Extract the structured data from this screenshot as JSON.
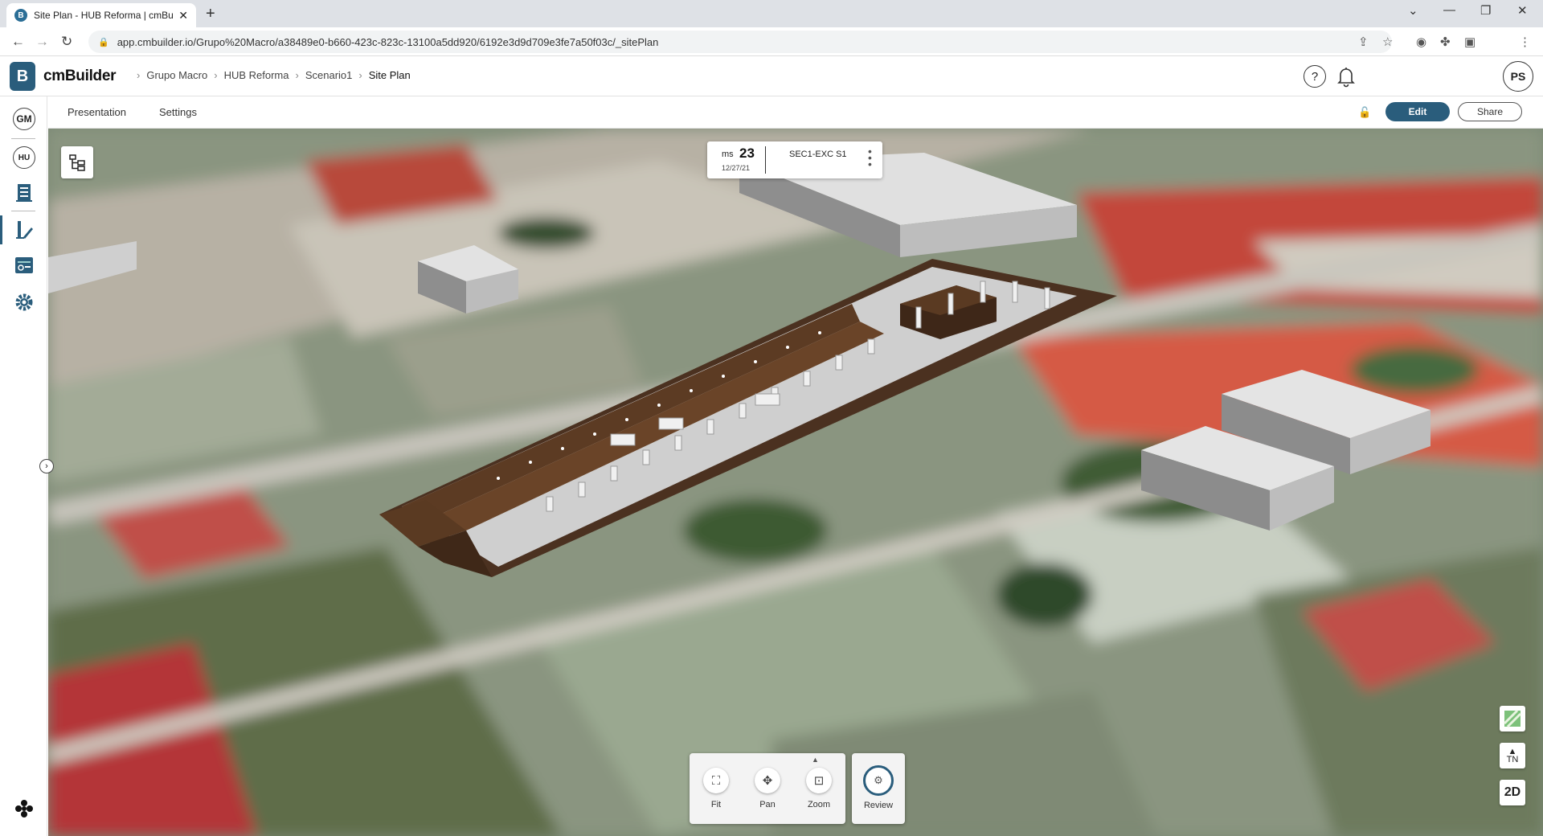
{
  "browser": {
    "tab_title": "Site Plan - HUB Reforma | cmBuil",
    "url": "app.cmbuilder.io/Grupo%20Macro/a38489e0-b660-423c-823c-13100a5dd920/6192e3d9d709e3fe7a50f03c/_sitePlan"
  },
  "app": {
    "logo_text": "cmBuilder",
    "breadcrumbs": [
      "Grupo Macro",
      "HUB Reforma",
      "Scenario1",
      "Site Plan"
    ],
    "user_initials": "PS",
    "help_label": "?"
  },
  "rail": {
    "org": "GM",
    "project": "HU"
  },
  "subbar": {
    "presentation": "Presentation",
    "settings": "Settings",
    "edit": "Edit",
    "share": "Share"
  },
  "milestone": {
    "prefix": "ms",
    "number": "23",
    "date": "12/27/21",
    "task": "SEC1-EXC S1"
  },
  "tools": {
    "fit": "Fit",
    "pan": "Pan",
    "zoom": "Zoom",
    "review": "Review"
  },
  "side": {
    "north": "TN",
    "mode": "2D"
  },
  "colors": {
    "accent": "#2a5d7c",
    "excavation": "#5a3b22"
  }
}
